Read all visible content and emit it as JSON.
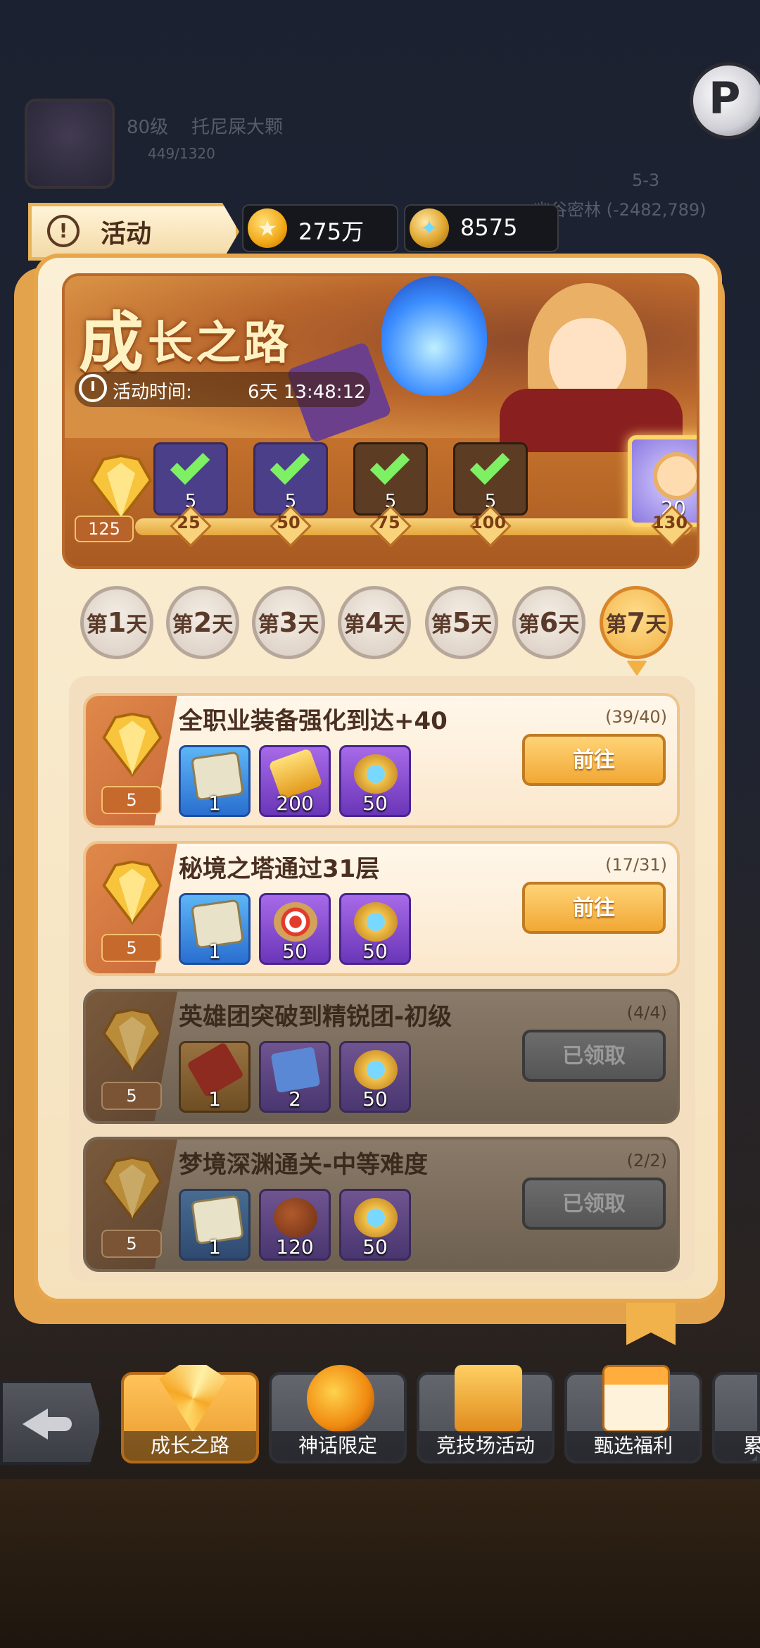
{
  "background": {
    "player_level": "80级",
    "player_name": "托尼屎大颗",
    "exp": "449/1320",
    "stage": "5-3",
    "location": "幽谷密林 (-2482,789)"
  },
  "topbar": {
    "tab_label": "活动",
    "gold": "275万",
    "gems": "8575"
  },
  "banner": {
    "title_big": "成",
    "title_rest": "长之路",
    "time_label": "活动时间:",
    "time_remaining": "6天 13:48:12"
  },
  "progress": {
    "current_points": "125",
    "milestones": [
      {
        "points": "25",
        "count": "5"
      },
      {
        "points": "50",
        "count": "5"
      },
      {
        "points": "75",
        "count": "5"
      },
      {
        "points": "100",
        "count": "5"
      },
      {
        "points": "130",
        "count": "20"
      }
    ]
  },
  "days": [
    {
      "pre": "第",
      "num": "1",
      "post": "天"
    },
    {
      "pre": "第",
      "num": "2",
      "post": "天"
    },
    {
      "pre": "第",
      "num": "3",
      "post": "天"
    },
    {
      "pre": "第",
      "num": "4",
      "post": "天"
    },
    {
      "pre": "第",
      "num": "5",
      "post": "天"
    },
    {
      "pre": "第",
      "num": "6",
      "post": "天"
    },
    {
      "pre": "第",
      "num": "7",
      "post": "天"
    }
  ],
  "tasks": [
    {
      "name": "全职业装备强化到达+40",
      "progress": "(39/40)",
      "points": "5",
      "items": [
        "1",
        "200",
        "50"
      ],
      "button": "前往"
    },
    {
      "name": "秘境之塔通过31层",
      "progress": "(17/31)",
      "points": "5",
      "items": [
        "1",
        "50",
        "50"
      ],
      "button": "前往"
    },
    {
      "name": "英雄团突破到精锐团-初级",
      "progress": "(4/4)",
      "points": "5",
      "items": [
        "1",
        "2",
        "50"
      ],
      "button": "已领取"
    },
    {
      "name": "梦境深渊通关-中等难度",
      "progress": "(2/2)",
      "points": "5",
      "items": [
        "1",
        "120",
        "50"
      ],
      "button": "已领取"
    }
  ],
  "nav": [
    {
      "label": "成长之路"
    },
    {
      "label": "神话限定"
    },
    {
      "label": "竞技场活动"
    },
    {
      "label": "甄选福利"
    },
    {
      "label": "累"
    }
  ]
}
